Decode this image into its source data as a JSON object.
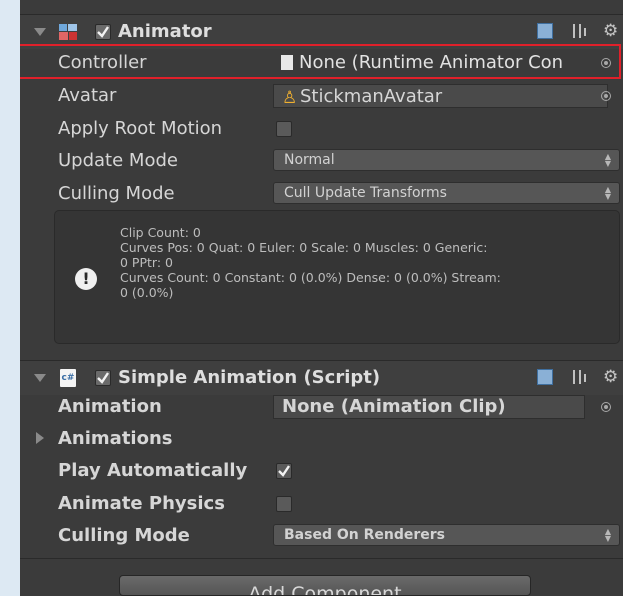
{
  "animator": {
    "title": "Animator",
    "enabled": true,
    "controller": {
      "label": "Controller",
      "value": "None (Runtime Animator Con"
    },
    "avatar": {
      "label": "Avatar",
      "value": "StickmanAvatar"
    },
    "apply_root_motion": {
      "label": "Apply Root Motion",
      "checked": false
    },
    "update_mode": {
      "label": "Update Mode",
      "value": "Normal"
    },
    "culling_mode": {
      "label": "Culling Mode",
      "value": "Cull Update Transforms"
    },
    "info": [
      "Clip Count: 0",
      "Curves Pos: 0 Quat: 0 Euler: 0 Scale: 0 Muscles: 0 Generic:",
      "0 PPtr: 0",
      "Curves Count: 0 Constant: 0 (0.0%) Dense: 0 (0.0%) Stream:",
      "0 (0.0%)"
    ]
  },
  "simple_animation": {
    "title": "Simple Animation (Script)",
    "enabled": true,
    "file_icon_text": "c#",
    "animation": {
      "label": "Animation",
      "value": "None (Animation Clip)"
    },
    "animations": {
      "label": "Animations"
    },
    "play_automatically": {
      "label": "Play Automatically",
      "checked": true
    },
    "animate_physics": {
      "label": "Animate Physics",
      "checked": false
    },
    "culling_mode": {
      "label": "Culling Mode",
      "value": "Based On Renderers"
    }
  },
  "footer": {
    "add_component_label": "Add Component"
  },
  "colors": {
    "panel": "#3b3b3b",
    "selection_border": "#e0202a",
    "page_bg": "#dde9f3"
  }
}
